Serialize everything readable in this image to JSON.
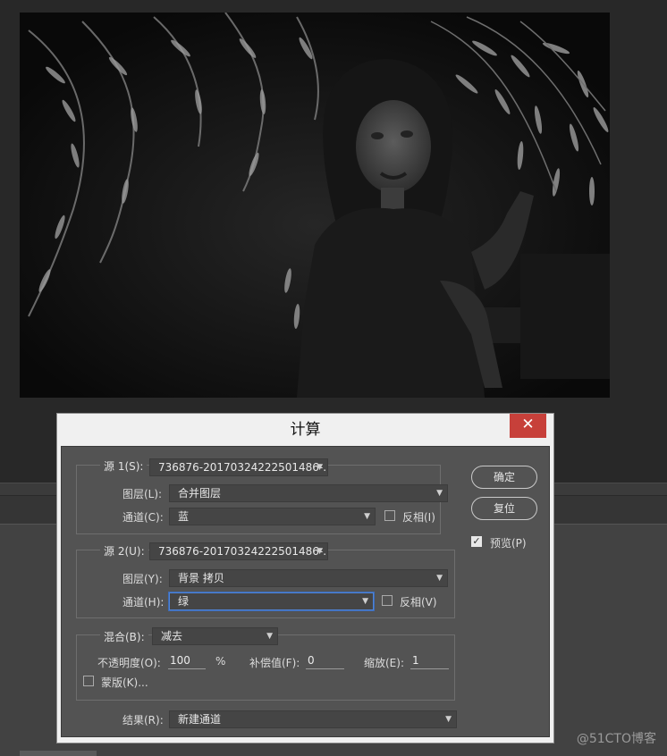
{
  "dialog": {
    "title": "计算",
    "close_glyph": "✕",
    "source1": {
      "legend": "源 1(S):",
      "file": "736876-20170324222501486-...",
      "layer_label": "图层(L):",
      "layer_value": "合并图层",
      "channel_label": "通道(C):",
      "channel_value": "蓝",
      "invert_label": "反相(I)",
      "invert_checked": false
    },
    "source2": {
      "legend": "源 2(U):",
      "file": "736876-20170324222501486-...",
      "layer_label": "图层(Y):",
      "layer_value": "背景 拷贝",
      "channel_label": "通道(H):",
      "channel_value": "绿",
      "invert_label": "反相(V)",
      "invert_checked": false
    },
    "blending": {
      "legend": "混合(B):",
      "mode_value": "减去",
      "opacity_label": "不透明度(O):",
      "opacity_value": "100",
      "opacity_unit": "%",
      "offset_label": "补偿值(F):",
      "offset_value": "0",
      "scale_label": "缩放(E):",
      "scale_value": "1",
      "mask_label": "蒙版(K)...",
      "mask_checked": false
    },
    "result": {
      "label": "结果(R):",
      "value": "新建通道"
    },
    "ok_label": "确定",
    "reset_label": "复位",
    "preview_label": "预览(P)",
    "preview_checked": true
  },
  "icons": {
    "dropdown": "chevron-down-icon",
    "close": "close-icon",
    "check": "checkmark-icon"
  },
  "watermark": "@51CTO博客",
  "colors": {
    "close_button": "#c7403a",
    "dialog_body": "#535353",
    "focus_border": "#4f84d8"
  }
}
